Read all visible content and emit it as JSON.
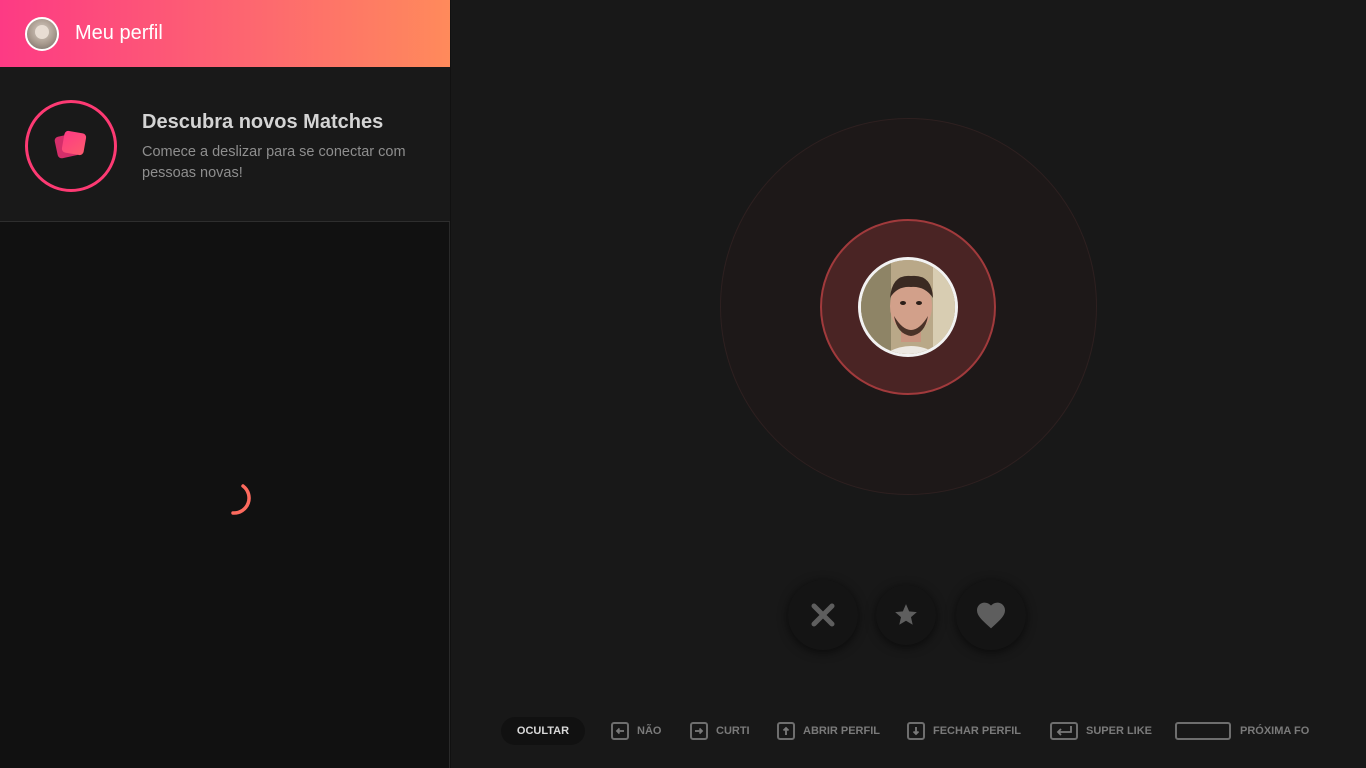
{
  "header": {
    "profile_label": "Meu perfil"
  },
  "discover": {
    "title": "Descubra novos Matches",
    "description": "Comece a deslizar para se conectar com pessoas novas!"
  },
  "actions": {
    "nope": "x-icon",
    "super_like": "star-icon",
    "like": "heart-icon"
  },
  "shortcuts": {
    "hide_label": "OCULTAR",
    "items": [
      {
        "label": "NÃO",
        "icon": "arrow-left-key-icon"
      },
      {
        "label": "CURTI",
        "icon": "arrow-right-key-icon"
      },
      {
        "label": "ABRIR PERFIL",
        "icon": "arrow-up-key-icon"
      },
      {
        "label": "FECHAR PERFIL",
        "icon": "arrow-down-key-icon"
      },
      {
        "label": "SUPER LIKE",
        "icon": "enter-key-icon"
      },
      {
        "label": "PRÓXIMA FO",
        "icon": "space-key-icon"
      }
    ]
  },
  "colors": {
    "accent": "#fd3a73",
    "gradient_start": "#fd3a84",
    "gradient_end": "#ff8a5b",
    "background": "#181818"
  }
}
